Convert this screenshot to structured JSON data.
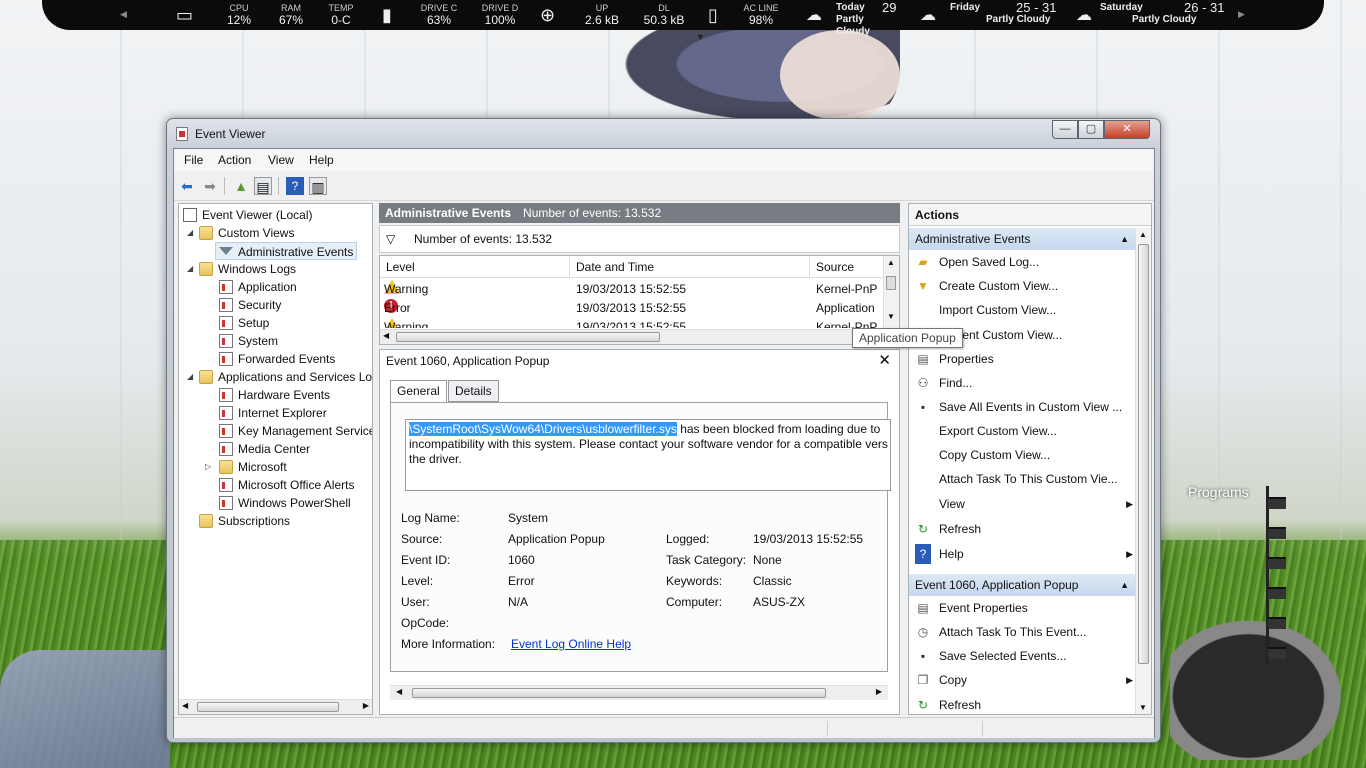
{
  "rainmeter": {
    "cpu_label": "CPU",
    "cpu": "12%",
    "ram_label": "RAM",
    "ram": "67%",
    "temp_label": "TEMP",
    "temp": "0-C",
    "drivec_label": "DRIVE C",
    "drivec": "63%",
    "drived_label": "DRIVE D",
    "drived": "100%",
    "up_label": "UP",
    "up": "2.6 kB",
    "dl_label": "DL",
    "dl": "50.3 kB",
    "ac_label": "AC LINE",
    "ac": "98%",
    "weather": [
      {
        "day": "Today",
        "temp": "29",
        "cond": "Partly Cloudy"
      },
      {
        "day": "Friday",
        "temp": "25 - 31",
        "cond": "Partly Cloudy"
      },
      {
        "day": "Saturday",
        "temp": "26 - 31",
        "cond": "Partly Cloudy"
      }
    ]
  },
  "desktop": {
    "programs": "Programs"
  },
  "window": {
    "title": "Event Viewer",
    "menu": [
      "File",
      "Action",
      "View",
      "Help"
    ],
    "tree": {
      "root": "Event Viewer (Local)",
      "custom_views": "Custom Views",
      "admin_events": "Administrative Events",
      "windows_logs": "Windows Logs",
      "logs": [
        "Application",
        "Security",
        "Setup",
        "System",
        "Forwarded Events"
      ],
      "apps_services": "Applications and Services Lo",
      "app_logs": [
        "Hardware Events",
        "Internet Explorer",
        "Key Management Service",
        "Media Center",
        "Microsoft",
        "Microsoft Office Alerts",
        "Windows PowerShell"
      ],
      "subscriptions": "Subscriptions"
    },
    "center": {
      "header_title": "Administrative Events",
      "header_count": "Number of events: 13.532",
      "filter_text": "Number of events: 13.532",
      "columns": [
        "Level",
        "Date and Time",
        "Source"
      ],
      "rows": [
        {
          "level": "Warning",
          "datetime": "19/03/2013 15:52:55",
          "source": "Kernel-PnP"
        },
        {
          "level": "Error",
          "datetime": "19/03/2013 15:52:55",
          "source": "Application"
        },
        {
          "level": "Warning",
          "datetime": "19/03/2013 15:52:55",
          "source": "Kernel-PnP"
        }
      ]
    },
    "tooltip": "Application Popup",
    "detail": {
      "title": "Event 1060, Application Popup",
      "tabs": [
        "General",
        "Details"
      ],
      "message_highlight": "\\SystemRoot\\SysWow64\\Drivers\\usblowerfilter.sys",
      "message_line1_rest": " has been blocked from loading due to",
      "message_line2": "incompatibility with this system. Please contact your software vendor for a compatible vers",
      "message_line3": "the driver.",
      "log_name_label": "Log Name:",
      "log_name": "System",
      "source_label": "Source:",
      "source": "Application Popup",
      "logged_label": "Logged:",
      "logged": "19/03/2013 15:52:55",
      "event_id_label": "Event ID:",
      "event_id": "1060",
      "task_label": "Task Category:",
      "task": "None",
      "level_label": "Level:",
      "level": "Error",
      "keywords_label": "Keywords:",
      "keywords": "Classic",
      "user_label": "User:",
      "user": "N/A",
      "computer_label": "Computer:",
      "computer": "ASUS-ZX",
      "opcode_label": "OpCode:",
      "more_info_label": "More Information:",
      "more_info_link": "Event Log Online Help"
    },
    "actions": {
      "title": "Actions",
      "section1": "Administrative Events",
      "items1": [
        {
          "label": "Open Saved Log...",
          "icon": "folder-open-icon"
        },
        {
          "label": "Create Custom View...",
          "icon": "filter-icon"
        },
        {
          "label": "Import Custom View...",
          "icon": ""
        },
        {
          "label": "Current Custom View...",
          "icon": ""
        },
        {
          "label": "Properties",
          "icon": "properties-icon"
        },
        {
          "label": "Find...",
          "icon": "binoculars-icon"
        },
        {
          "label": "Save All Events in Custom View ...",
          "icon": "save-icon"
        },
        {
          "label": "Export Custom View...",
          "icon": ""
        },
        {
          "label": "Copy Custom View...",
          "icon": ""
        },
        {
          "label": "Attach Task To This Custom Vie...",
          "icon": ""
        },
        {
          "label": "View",
          "icon": ""
        },
        {
          "label": "Refresh",
          "icon": "refresh-icon"
        },
        {
          "label": "Help",
          "icon": "help-icon"
        }
      ],
      "section2": "Event 1060, Application Popup",
      "items2": [
        {
          "label": "Event Properties",
          "icon": "properties-icon"
        },
        {
          "label": "Attach Task To This Event...",
          "icon": "clock-icon"
        },
        {
          "label": "Save Selected Events...",
          "icon": "save-icon"
        },
        {
          "label": "Copy",
          "icon": "copy-icon"
        },
        {
          "label": "Refresh",
          "icon": "refresh-icon"
        }
      ]
    }
  }
}
